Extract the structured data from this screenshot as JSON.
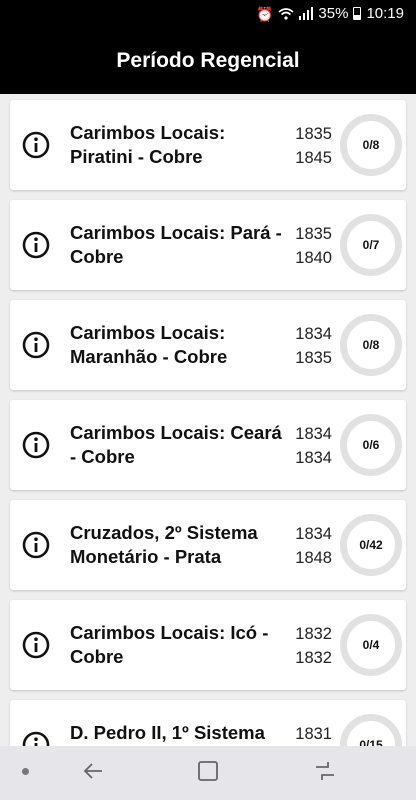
{
  "status": {
    "battery_percent": "35%",
    "time": "10:19"
  },
  "header": {
    "title": "Período Regencial"
  },
  "items": [
    {
      "title": "Carimbos Locais: Piratini - Cobre",
      "year_start": "1835",
      "year_end": "1845",
      "progress": "0/8"
    },
    {
      "title": "Carimbos Locais: Pará - Cobre",
      "year_start": "1835",
      "year_end": "1840",
      "progress": "0/7"
    },
    {
      "title": "Carimbos Locais: Maranhão - Cobre",
      "year_start": "1834",
      "year_end": "1835",
      "progress": "0/8"
    },
    {
      "title": "Carimbos Locais: Ceará - Cobre",
      "year_start": "1834",
      "year_end": "1834",
      "progress": "0/6"
    },
    {
      "title": "Cruzados, 2º Sistema Monetário - Prata",
      "year_start": "1834",
      "year_end": "1848",
      "progress": "0/42"
    },
    {
      "title": "Carimbos Locais: Icó - Cobre",
      "year_start": "1832",
      "year_end": "1832",
      "progress": "0/4"
    },
    {
      "title": "D. Pedro II, 1º Sistema",
      "year_start": "1831",
      "year_end": "",
      "progress": "0/15"
    }
  ],
  "icons": {
    "item_info": "info-circle-icon",
    "nav_back": "back-arrow-icon",
    "nav_home": "home-square-icon",
    "nav_recents": "recents-icon"
  }
}
